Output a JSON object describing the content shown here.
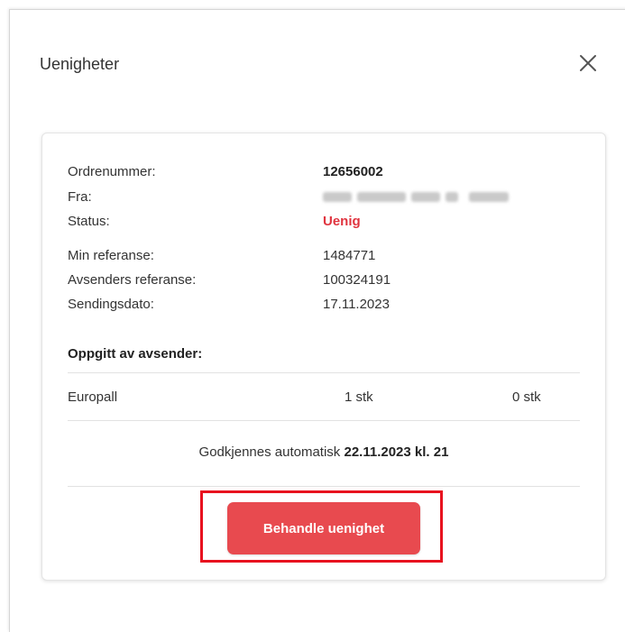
{
  "modal": {
    "title": "Uenigheter",
    "close_icon": "close-icon"
  },
  "details": [
    {
      "label": "Ordrenummer:",
      "value": "12656002"
    },
    {
      "label": "Fra:",
      "value": ""
    },
    {
      "label": "Status:",
      "value": "Uenig"
    },
    {
      "label": "Min referanse:",
      "value": "1484771"
    },
    {
      "label": "Avsenders referanse:",
      "value": "100324191"
    },
    {
      "label": "Sendingsdato:",
      "value": "17.11.2023"
    }
  ],
  "sender_section": {
    "title": "Oppgitt av avsender:",
    "items": [
      {
        "name": "Europall",
        "quantity_stated": "1 stk",
        "quantity_received": "0 stk"
      }
    ]
  },
  "auto_approve": {
    "prefix": "Godkjennes automatisk",
    "datetime": "22.11.2023 kl. 21"
  },
  "action": {
    "label": "Behandle uenighet"
  },
  "colors": {
    "status_red": "#e0343f",
    "button_red": "#e84a4f",
    "highlight": "#e8121f"
  }
}
